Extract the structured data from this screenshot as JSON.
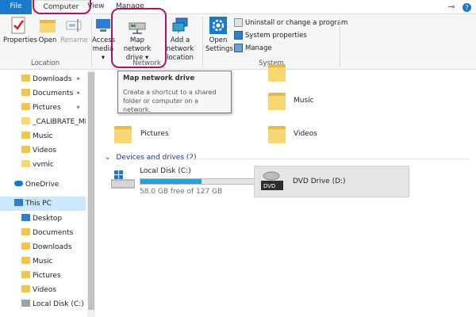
{
  "tabs": {
    "file": "File",
    "computer": "Computer",
    "view": "View",
    "manage": "Manage"
  },
  "ribbon": {
    "location": {
      "label": "Location",
      "properties": "Properties",
      "open": "Open",
      "rename": "Rename"
    },
    "network": {
      "label": "Network",
      "access_media_line1": "Access",
      "access_media_line2": "media",
      "map_drive_line1": "Map network",
      "map_drive_line2": "drive",
      "add_location_line1": "Add a network",
      "add_location_line2": "location"
    },
    "system": {
      "label": "System",
      "open_settings_line1": "Open",
      "open_settings_line2": "Settings",
      "uninstall": "Uninstall or change a program",
      "system_properties": "System properties",
      "manage": "Manage"
    }
  },
  "tooltip": {
    "title": "Map network drive",
    "description": "Create a shortcut to a shared folder or computer on a network."
  },
  "nav": {
    "items": [
      {
        "label": "Downloads",
        "pinned": true
      },
      {
        "label": "Documents",
        "pinned": true
      },
      {
        "label": "Pictures",
        "pinned": true
      },
      {
        "label": "_CALIBRATE_ME",
        "pinned": false
      },
      {
        "label": "Music",
        "pinned": false
      },
      {
        "label": "Videos",
        "pinned": false
      },
      {
        "label": "vvmic",
        "pinned": false
      },
      {
        "label": "OneDrive",
        "pinned": false
      },
      {
        "label": "This PC",
        "pinned": false
      },
      {
        "label": "Desktop",
        "pinned": false
      },
      {
        "label": "Documents",
        "pinned": false
      },
      {
        "label": "Downloads",
        "pinned": false
      },
      {
        "label": "Music",
        "pinned": false
      },
      {
        "label": "Pictures",
        "pinned": false
      },
      {
        "label": "Videos",
        "pinned": false
      },
      {
        "label": "Local Disk (C:)",
        "pinned": false
      }
    ]
  },
  "content": {
    "folders": [
      {
        "label": "Music"
      },
      {
        "label": "Pictures"
      },
      {
        "label": "Videos"
      }
    ],
    "devices_header": "Devices and drives (2)",
    "drives": [
      {
        "label": "Local Disk (C:)",
        "free_text": "58.0 GB free of 127 GB",
        "used_fraction": 0.54
      },
      {
        "label": "DVD Drive (D:)"
      }
    ]
  },
  "colors": {
    "file_tab": "#1979ca",
    "annotation": "#a8185c",
    "selection": "#cce8ff",
    "drive_bar": "#26a0da"
  }
}
